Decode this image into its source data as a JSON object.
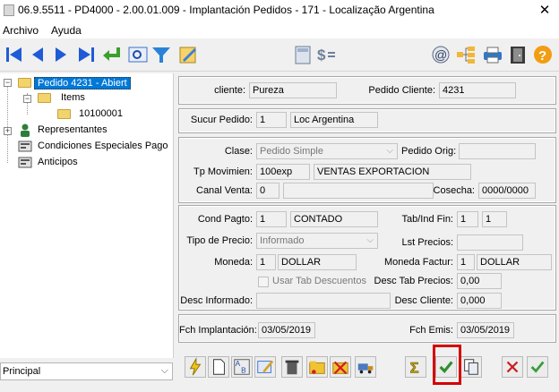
{
  "window": {
    "title": "06.9.5511 - PD4000 - 2.00.01.009 - Implantación Pedidos - 171 - Localização Argentina",
    "close_glyph": "✕"
  },
  "menu": [
    "Archivo",
    "Ayuda"
  ],
  "toolbar_icons": [
    "first-record-icon",
    "prev-record-icon",
    "next-record-icon",
    "last-record-icon",
    "return-icon",
    "preview-icon",
    "filter-icon",
    "edit-document-icon",
    "calculator-icon",
    "currency-icon",
    "at-sign-icon",
    "tree-structure-icon",
    "printer-icon",
    "exit-door-icon",
    "help-icon"
  ],
  "tree": {
    "root": "Pedido 4231 - Abiert",
    "items": "Items",
    "item_child": "10100001",
    "representantes": "Representantes",
    "condiciones": "Condiciones Especiales Pago",
    "anticipos": "Anticipos"
  },
  "bottom_combo": {
    "value": "Principal"
  },
  "form": {
    "cliente_label": "cliente:",
    "cliente_value": "Pureza",
    "pedido_cliente_label": "Pedido Cliente:",
    "pedido_cliente_value": "4231",
    "sucur_label": "Sucur Pedido:",
    "sucur_code": "1",
    "sucur_name": "Loc Argentina",
    "clase_label": "Clase:",
    "clase_value": "Pedido Simple",
    "pedido_orig_label": "Pedido Orig:",
    "pedido_orig_value": "",
    "tp_mov_label": "Tp Movimien:",
    "tp_mov_code": "100exp",
    "tp_mov_name": "VENTAS EXPORTACION",
    "canal_label": "Canal Venta:",
    "canal_code": "0",
    "canal_name": "",
    "cosecha_label": "Cosecha:",
    "cosecha_value": "0000/0000",
    "cond_label": "Cond Pagto:",
    "cond_code": "1",
    "cond_name": "CONTADO",
    "tab_ind_label": "Tab/Ind Fin:",
    "tab_ind_1": "1",
    "tab_ind_2": "1",
    "tipo_precio_label": "Tipo de Precio:",
    "tipo_precio_value": "Informado",
    "lst_precios_label": "Lst Precios:",
    "lst_precios_value": "",
    "moneda_label": "Moneda:",
    "moneda_code": "1",
    "moneda_name": "DOLLAR",
    "moneda_fact_label": "Moneda Factur:",
    "moneda_fact_code": "1",
    "moneda_fact_name": "DOLLAR",
    "usar_tab_label": "Usar Tab Descuentos",
    "desc_tab_label": "Desc Tab Precios:",
    "desc_tab_value": "0,00",
    "desc_inf_label": "Desc Informado:",
    "desc_inf_value": "",
    "desc_cli_label": "Desc Cliente:",
    "desc_cli_value": "0,000",
    "fch_impl_label": "Fch Implantación:",
    "fch_impl_value": "03/05/2019",
    "fch_emis_label": "Fch Emis:",
    "fch_emis_value": "03/05/2019"
  },
  "actions": [
    "lightning-icon",
    "new-document-icon",
    "spell-check-icon",
    "edit-image-icon",
    "trash-icon",
    "open-folder-icon",
    "cancel-folder-icon",
    "truck-icon",
    "sigma-icon",
    "confirm-check-icon",
    "copy-document-icon",
    "cancel-x-icon",
    "ok-check-icon"
  ]
}
